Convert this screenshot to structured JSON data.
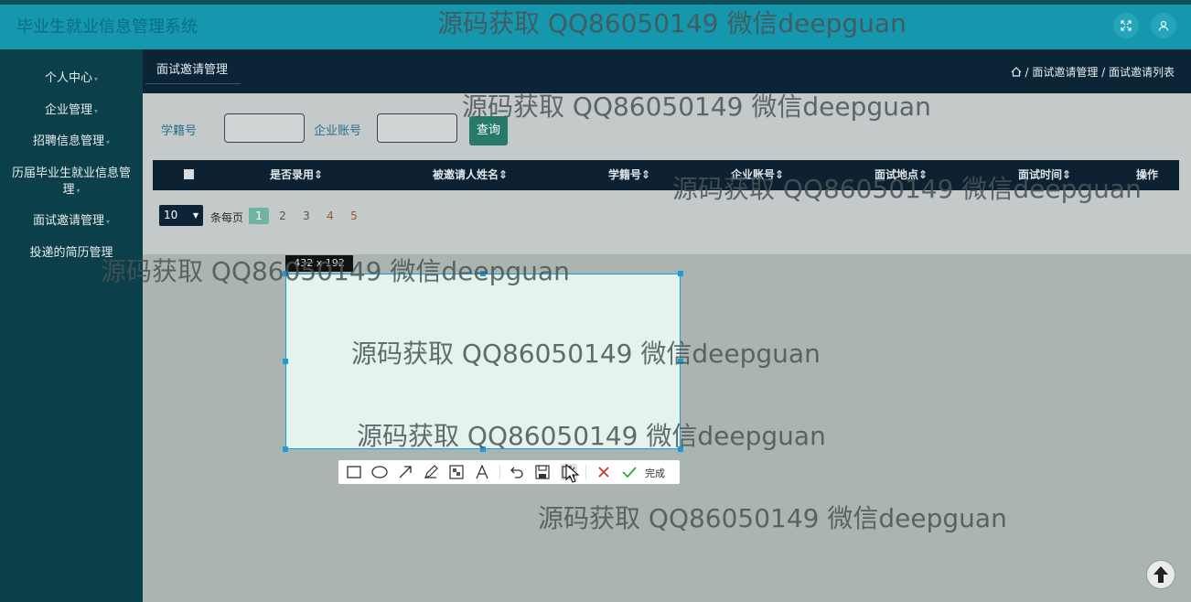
{
  "app": {
    "title": "毕业生就业信息管理系统"
  },
  "sidebar": {
    "items": [
      {
        "label": "个人中心"
      },
      {
        "label": "企业管理"
      },
      {
        "label": "招聘信息管理"
      },
      {
        "label": "历届毕业生就业信息管理"
      },
      {
        "label": "面试邀请管理"
      },
      {
        "label": "投递的简历管理"
      }
    ]
  },
  "header": {
    "tab": "面试邀请管理",
    "breadcrumb": "/ 面试邀请管理 / 面试邀请列表"
  },
  "search": {
    "student_label": "学籍号",
    "company_label": "企业账号",
    "query_button": "查询"
  },
  "table": {
    "columns": [
      "是否录用",
      "被邀请人姓名",
      "学籍号",
      "企业账号",
      "面试地点",
      "面试时间",
      "操作"
    ]
  },
  "pager": {
    "page_size": "10",
    "per_page_label": "条每页",
    "pages": [
      "1",
      "2",
      "3",
      "4",
      "5"
    ]
  },
  "screenshot_tool": {
    "size_label": "432 x 192",
    "done_label": "完成"
  },
  "watermark": "源码获取 QQ86050149 微信deepguan",
  "colors": {
    "topbar": "#1597ad",
    "sidebar": "#0b3f4a",
    "header": "#0b2537",
    "accent": "#267a68",
    "selection_border": "#1d9bd6"
  }
}
